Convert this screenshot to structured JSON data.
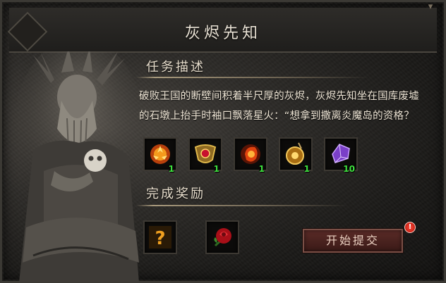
{
  "window": {
    "title": "灰烬先知"
  },
  "task": {
    "section_title": "任务描述",
    "description_line1": "破败王国的断壁间积着半尺厚的灰烬，灰烬先知坐在国库废墟",
    "description_line2": "的石墩上抬手时袖口飘落星火：“想拿到撒离炎魔岛的资格？",
    "items": [
      {
        "icon": "fire-rune-icon",
        "qty": "1"
      },
      {
        "icon": "golden-amulet-icon",
        "qty": "1"
      },
      {
        "icon": "flame-orb-icon",
        "qty": "1"
      },
      {
        "icon": "gold-pendant-icon",
        "qty": "1"
      },
      {
        "icon": "purple-crystal-icon",
        "qty": "10"
      }
    ]
  },
  "reward": {
    "section_title": "完成奖励",
    "items": [
      {
        "icon": "mystery-question-icon"
      },
      {
        "icon": "red-rose-icon"
      }
    ]
  },
  "actions": {
    "submit_label": "开始提交",
    "alert_badge": "!"
  },
  "colors": {
    "quantity": "#3ee03e",
    "button": "#5a2b27",
    "title_text": "#e8e1d4"
  }
}
